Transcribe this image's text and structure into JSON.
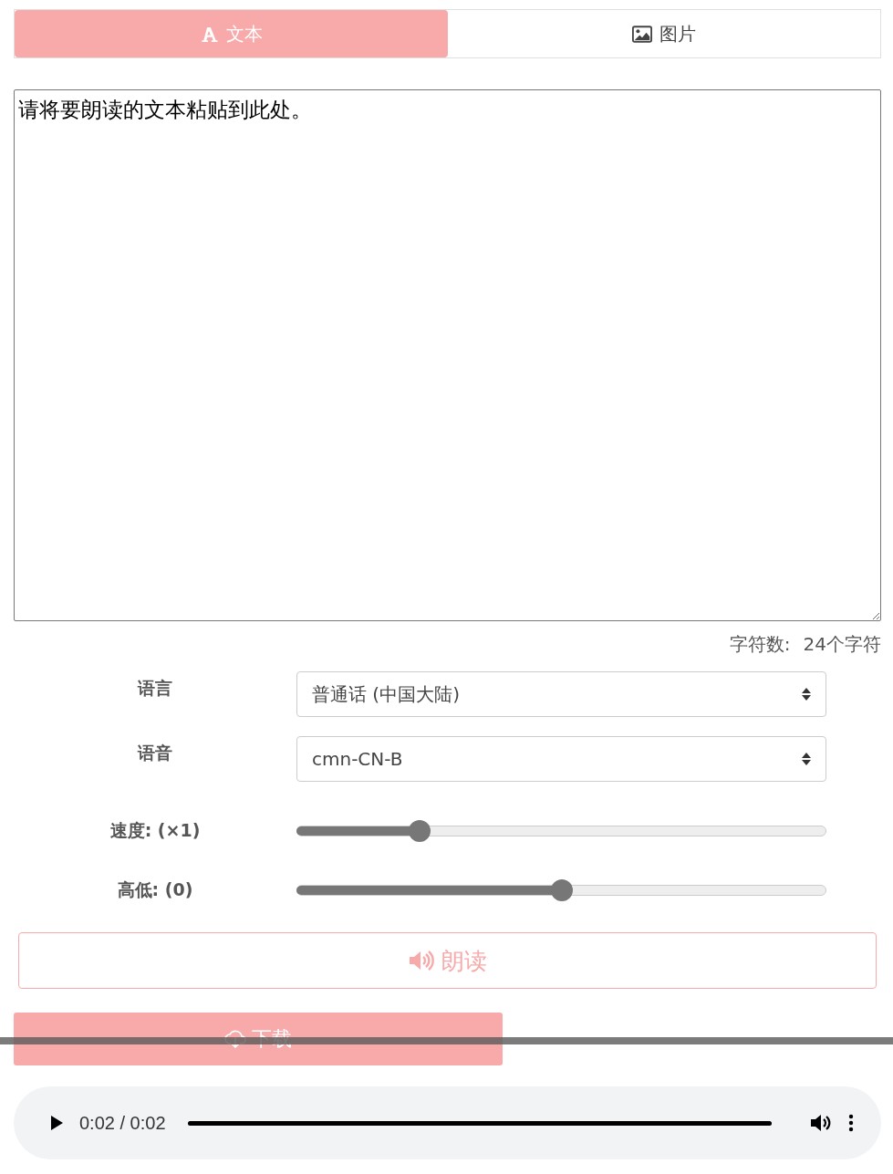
{
  "tabs": [
    {
      "kind": "text",
      "label": "文本",
      "selected": true
    },
    {
      "kind": "image",
      "label": "图片",
      "selected": false
    }
  ],
  "text_input": {
    "value": "请将要朗读的文本粘贴到此处。"
  },
  "char_count": {
    "label": "字符数:",
    "value": "24个字符"
  },
  "settings": [
    {
      "kind": "select",
      "label": "语言",
      "value": "普通话 (中国大陆)"
    },
    {
      "kind": "select",
      "label": "语音",
      "value": "cmn-CN-B"
    },
    {
      "kind": "slider",
      "label": "速度: (×1)",
      "level": 0.22
    },
    {
      "kind": "slider",
      "label": "高低: (0)",
      "level": 0.5
    }
  ],
  "read_button": {
    "label": "朗读"
  },
  "download_button": {
    "label": "下载"
  },
  "audio": {
    "time": "0:02 / 0:02",
    "level": 1
  }
}
